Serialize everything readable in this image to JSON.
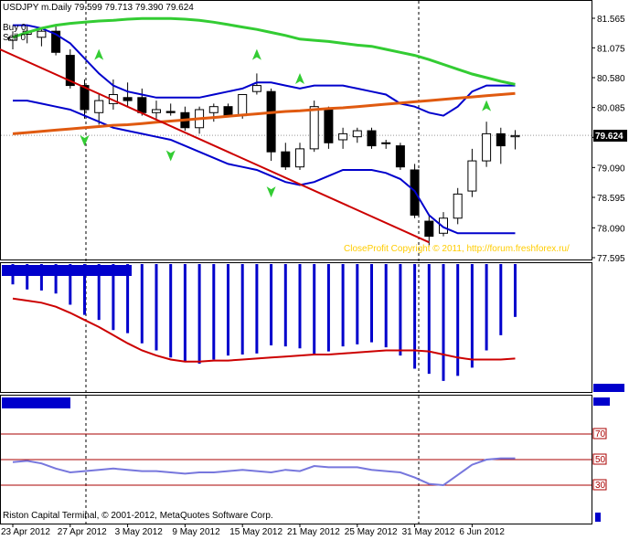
{
  "symbol_title": "USDJPY  m.Daily  79.599 79.713 79.390 79.624",
  "trade_line_1": "Buy 0",
  "trade_line_2": "Sell 0",
  "current_price": "79.624",
  "copyright_watermark": "CloseProfit Copyright © 2011, http://forum.freshforex.ru/",
  "terminal_footer": "Riston Capital Terminal, © 2001-2012, MetaQuotes Software Corp.",
  "colors": {
    "bullish_candle": "#ffffff",
    "bearish_candle": "#000000",
    "bollinger_bands": "#0000cc",
    "slow_ma": "#33cc33",
    "mid_ma": "#e05a10",
    "trendline": "#cc0000",
    "arrows": "#33cc33",
    "histogram": "#0000cc",
    "signal_line": "#cc0000",
    "oscillator_line": "#7777dd",
    "level_lines": "#aa0000",
    "watermark": "#ffcc00"
  },
  "chart_data": [
    {
      "type": "candlestick",
      "panel": "main",
      "x_labels": [
        "23 Apr 2012",
        "27 Apr 2012",
        "3 May 2012",
        "9 May 2012",
        "15 May 2012",
        "21 May 2012",
        "25 May 2012",
        "31 May 2012",
        "6 Jun 2012"
      ],
      "y_ticks": [
        "81.565",
        "81.075",
        "80.580",
        "80.085",
        "79.590",
        "79.090",
        "78.595",
        "78.090",
        "77.595"
      ],
      "ylim": [
        77.595,
        81.565
      ],
      "candles": [
        {
          "o": 81.2,
          "h": 81.35,
          "l": 81.05,
          "c": 81.25
        },
        {
          "o": 81.3,
          "h": 81.45,
          "l": 81.15,
          "c": 81.35
        },
        {
          "o": 81.25,
          "h": 81.4,
          "l": 81.1,
          "c": 81.35
        },
        {
          "o": 81.35,
          "h": 81.45,
          "l": 80.95,
          "c": 81.0
        },
        {
          "o": 80.95,
          "h": 81.05,
          "l": 80.4,
          "c": 80.45
        },
        {
          "o": 80.45,
          "h": 80.55,
          "l": 79.9,
          "c": 80.05
        },
        {
          "o": 80.0,
          "h": 80.3,
          "l": 79.8,
          "c": 80.2
        },
        {
          "o": 80.15,
          "h": 80.55,
          "l": 80.05,
          "c": 80.3
        },
        {
          "o": 80.25,
          "h": 80.5,
          "l": 80.1,
          "c": 80.2
        },
        {
          "o": 80.25,
          "h": 80.4,
          "l": 79.95,
          "c": 80.0
        },
        {
          "o": 80.0,
          "h": 80.2,
          "l": 79.9,
          "c": 80.05
        },
        {
          "o": 80.02,
          "h": 80.15,
          "l": 79.95,
          "c": 80.0
        },
        {
          "o": 80.0,
          "h": 80.1,
          "l": 79.7,
          "c": 79.75
        },
        {
          "o": 79.75,
          "h": 80.1,
          "l": 79.65,
          "c": 80.05
        },
        {
          "o": 80.0,
          "h": 80.15,
          "l": 79.85,
          "c": 80.1
        },
        {
          "o": 80.1,
          "h": 80.15,
          "l": 79.95,
          "c": 79.95
        },
        {
          "o": 79.95,
          "h": 80.3,
          "l": 79.9,
          "c": 80.3
        },
        {
          "o": 80.35,
          "h": 80.65,
          "l": 80.3,
          "c": 80.45
        },
        {
          "o": 80.35,
          "h": 80.4,
          "l": 79.2,
          "c": 79.35
        },
        {
          "o": 79.35,
          "h": 79.5,
          "l": 79.05,
          "c": 79.1
        },
        {
          "o": 79.1,
          "h": 79.5,
          "l": 79.05,
          "c": 79.4
        },
        {
          "o": 79.4,
          "h": 80.2,
          "l": 79.35,
          "c": 80.1
        },
        {
          "o": 80.05,
          "h": 80.1,
          "l": 79.4,
          "c": 79.5
        },
        {
          "o": 79.55,
          "h": 79.75,
          "l": 79.4,
          "c": 79.65
        },
        {
          "o": 79.6,
          "h": 79.75,
          "l": 79.5,
          "c": 79.7
        },
        {
          "o": 79.7,
          "h": 79.75,
          "l": 79.4,
          "c": 79.45
        },
        {
          "o": 79.5,
          "h": 79.55,
          "l": 79.4,
          "c": 79.5
        },
        {
          "o": 79.45,
          "h": 79.5,
          "l": 79.05,
          "c": 79.1
        },
        {
          "o": 79.05,
          "h": 79.15,
          "l": 78.25,
          "c": 78.3
        },
        {
          "o": 78.2,
          "h": 78.3,
          "l": 77.8,
          "c": 77.95
        },
        {
          "o": 78.0,
          "h": 78.35,
          "l": 77.95,
          "c": 78.25
        },
        {
          "o": 78.25,
          "h": 78.75,
          "l": 78.15,
          "c": 78.65
        },
        {
          "o": 78.7,
          "h": 79.4,
          "l": 78.6,
          "c": 79.2
        },
        {
          "o": 79.2,
          "h": 79.85,
          "l": 79.1,
          "c": 79.65
        },
        {
          "o": 79.65,
          "h": 79.75,
          "l": 79.15,
          "c": 79.45
        },
        {
          "o": 79.6,
          "h": 79.71,
          "l": 79.39,
          "c": 79.62
        }
      ],
      "bollinger_upper": [
        81.45,
        81.45,
        81.4,
        81.3,
        81.15,
        80.9,
        80.65,
        80.45,
        80.35,
        80.3,
        80.25,
        80.25,
        80.25,
        80.25,
        80.3,
        80.35,
        80.4,
        80.5,
        80.5,
        80.45,
        80.4,
        80.45,
        80.45,
        80.45,
        80.4,
        80.35,
        80.3,
        80.15,
        80.1,
        80.0,
        79.95,
        80.1,
        80.35,
        80.45,
        80.45,
        80.45
      ],
      "bollinger_lower": [
        80.2,
        80.2,
        80.15,
        80.1,
        80.05,
        79.95,
        79.85,
        79.75,
        79.7,
        79.65,
        79.6,
        79.55,
        79.45,
        79.35,
        79.25,
        79.15,
        79.1,
        79.05,
        78.95,
        78.85,
        78.8,
        78.85,
        78.95,
        79.05,
        79.05,
        79.05,
        79.0,
        78.9,
        78.7,
        78.3,
        78.1,
        78.0,
        78.0,
        78.0,
        78.0,
        78.0
      ],
      "slow_ma": [
        81.25,
        81.33,
        81.4,
        81.45,
        81.48,
        81.5,
        81.52,
        81.53,
        81.55,
        81.56,
        81.56,
        81.56,
        81.55,
        81.53,
        81.5,
        81.46,
        81.42,
        81.38,
        81.33,
        81.28,
        81.22,
        81.2,
        81.18,
        81.15,
        81.12,
        81.1,
        81.05,
        81.0,
        80.95,
        80.88,
        80.8,
        80.72,
        80.64,
        80.58,
        80.52,
        80.47
      ],
      "mid_ma": [
        79.65,
        79.67,
        79.69,
        79.71,
        79.73,
        79.75,
        79.77,
        79.79,
        79.8,
        79.82,
        79.84,
        79.86,
        79.88,
        79.9,
        79.92,
        79.94,
        79.96,
        79.98,
        80.0,
        80.02,
        80.03,
        80.05,
        80.07,
        80.08,
        80.1,
        80.12,
        80.14,
        80.16,
        80.18,
        80.2,
        80.22,
        80.24,
        80.26,
        80.28,
        80.3,
        80.32
      ],
      "trendline": {
        "start": [
          0,
          81.05
        ],
        "end": [
          29,
          77.85
        ]
      },
      "up_arrows": [
        {
          "i": 6,
          "v": 80.95
        },
        {
          "i": 17,
          "v": 80.95
        },
        {
          "i": 20,
          "v": 80.55
        },
        {
          "i": 33,
          "v": 80.1
        }
      ],
      "down_arrows": [
        {
          "i": 5,
          "v": 79.55
        },
        {
          "i": 11,
          "v": 79.3
        },
        {
          "i": 18,
          "v": 78.7
        }
      ]
    },
    {
      "type": "bar",
      "panel": "histogram",
      "title_box": "",
      "values": [
        -2.0,
        -2.5,
        -2.6,
        -2.9,
        -4.0,
        -5.0,
        -5.5,
        -6.5,
        -6.8,
        -7.8,
        -8.5,
        -9.2,
        -9.6,
        -9.8,
        -9.4,
        -9.0,
        -8.9,
        -8.8,
        -8.0,
        -8.1,
        -8.3,
        -8.9,
        -8.6,
        -8.1,
        -7.9,
        -7.7,
        -8.2,
        -9.0,
        -10.3,
        -10.8,
        -11.5,
        -11.0,
        -10.2,
        -8.5,
        -7.0,
        -5.2
      ],
      "signal": [
        -3.4,
        -3.6,
        -3.8,
        -4.2,
        -4.8,
        -5.5,
        -6.2,
        -7.0,
        -7.8,
        -8.5,
        -9.0,
        -9.4,
        -9.6,
        -9.6,
        -9.5,
        -9.5,
        -9.4,
        -9.3,
        -9.2,
        -9.1,
        -9.0,
        -8.9,
        -8.9,
        -8.8,
        -8.7,
        -8.6,
        -8.5,
        -8.5,
        -8.5,
        -8.6,
        -8.9,
        -9.2,
        -9.4,
        -9.4,
        -9.4,
        -9.3
      ],
      "ylim": [
        -12.5,
        0
      ]
    },
    {
      "type": "line",
      "panel": "oscillator",
      "title_box": "",
      "level_labels": [
        "70",
        "50",
        "30"
      ],
      "levels": [
        70,
        50,
        30
      ],
      "values": [
        48,
        49,
        47,
        43,
        40,
        41,
        42,
        43,
        42,
        41,
        41,
        40,
        39,
        40,
        40,
        41,
        42,
        41,
        40,
        42,
        41,
        45,
        44,
        44,
        44,
        42,
        41,
        40,
        36,
        31,
        30,
        38,
        46,
        50,
        51,
        51
      ],
      "ylim": [
        0,
        100
      ]
    }
  ]
}
